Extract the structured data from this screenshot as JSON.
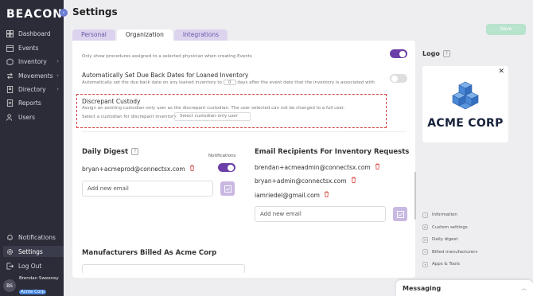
{
  "brand": {
    "name": "BEACON",
    "collapse_icon": "chevron-left-icon"
  },
  "sidebar": {
    "items": [
      {
        "label": "Dashboard",
        "icon": "dashboard-icon",
        "has_submenu": false
      },
      {
        "label": "Events",
        "icon": "calendar-icon",
        "has_submenu": false
      },
      {
        "label": "Inventory",
        "icon": "box-icon",
        "has_submenu": true
      },
      {
        "label": "Movements",
        "icon": "arrows-icon",
        "has_submenu": true
      },
      {
        "label": "Directory",
        "icon": "directory-icon",
        "has_submenu": true
      },
      {
        "label": "Reports",
        "icon": "reports-icon",
        "has_submenu": false
      },
      {
        "label": "Users",
        "icon": "users-icon",
        "has_submenu": false
      }
    ],
    "bottom_items": [
      {
        "label": "Notifications",
        "icon": "bell-icon"
      },
      {
        "label": "Settings",
        "icon": "gear-icon",
        "active": true
      },
      {
        "label": "Log Out",
        "icon": "logout-icon"
      }
    ],
    "user": {
      "initials": "BS",
      "name": "Brendan Sweeney",
      "org": "Acme Corp"
    }
  },
  "header": {
    "title": "Settings",
    "save_label": "Save"
  },
  "tabs": [
    {
      "label": "Personal",
      "active": false
    },
    {
      "label": "Organization",
      "active": true
    },
    {
      "label": "Integrations",
      "active": false
    }
  ],
  "settings": {
    "physician_filter_desc": "Only show procedures assigned to a selected physician when creating Events",
    "due_back": {
      "title": "Automatically Set Due Back Dates for Loaned Inventory",
      "desc_before": "Automatically set the due back date on any loaned inventory to",
      "days": "0",
      "desc_after": "days after the event date that the inventory is associated with"
    },
    "discrepant": {
      "title": "Discrepant Custody",
      "desc": "Assign an existing custodian-only user as the discrepant custodian. The user selected can not be changed to a full user.",
      "select_label": "Select a custodian for discrepant inventory",
      "select_placeholder": "Select custodian-only user"
    }
  },
  "daily_digest": {
    "title": "Daily Digest",
    "notifications_label": "Notifications",
    "email": "bryan+acmeprod@connectsx.com",
    "add_placeholder": "Add new email"
  },
  "email_recipients": {
    "title": "Email Recipients For Inventory Requests",
    "emails": [
      "brendan+acmeadmin@connectsx.com",
      "bryan+admin@connectsx.com",
      "iamriedel@gmail.com"
    ],
    "add_placeholder": "Add new email"
  },
  "manufacturers": {
    "title": "Manufacturers Billed As Acme Corp"
  },
  "logo": {
    "title": "Logo",
    "company_text": "ACME CORP",
    "cube_color": "#4a87d6"
  },
  "anchors": [
    {
      "label": "Information"
    },
    {
      "label": "Custom settings"
    },
    {
      "label": "Daily digest"
    },
    {
      "label": "Billed manufacturers"
    },
    {
      "label": "Apps & Tools"
    }
  ],
  "messaging": {
    "label": "Messaging"
  },
  "colors": {
    "sidebar_bg": "#2b2c38",
    "accent_purple": "#6b3fa7",
    "danger": "#d63c3c",
    "save_green": "#b8e3cc"
  }
}
